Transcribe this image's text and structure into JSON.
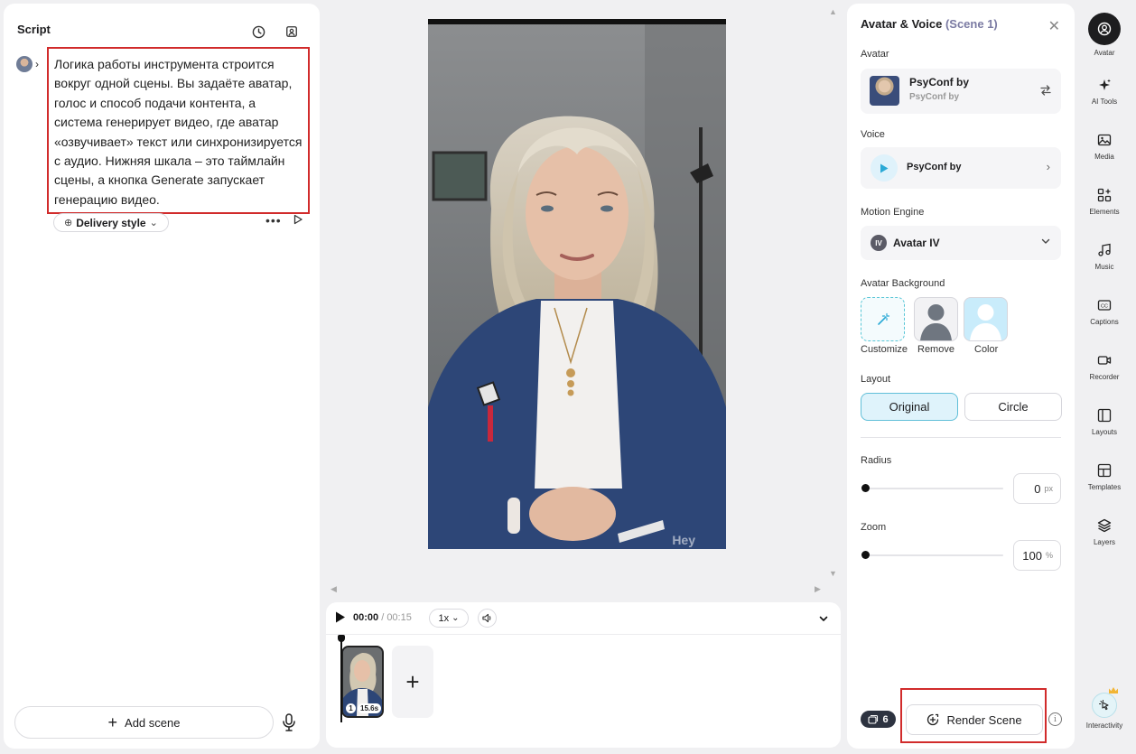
{
  "script_panel": {
    "title": "Script",
    "script_text": "Логика работы инструмента строится вокруг одной сцены. Вы задаёте аватар, голос и способ подачи контента, а система генерирует видео, где аватар «озвучивает» текст или синхронизируется с аудио. Нижняя шкала – это таймлайн сцены, а кнопка Generate запускает генерацию видео.",
    "delivery_style_label": "Delivery style",
    "add_scene_label": "Add scene"
  },
  "preview": {
    "watermark": "Hey"
  },
  "timeline": {
    "current_time": "00:00",
    "separator": " / ",
    "total_time": "00:15",
    "speed": "1x",
    "scenes": [
      {
        "number": "1",
        "duration": "15.6s"
      }
    ]
  },
  "props_panel": {
    "title": "Avatar & Voice",
    "scene_label": "(Scene 1)",
    "avatar_label": "Avatar",
    "avatar_name": "PsyConf by",
    "avatar_sub": "PsyConf by",
    "voice_label": "Voice",
    "voice_name": "PsyConf by",
    "motion_engine_label": "Motion Engine",
    "engine_badge": "IV",
    "engine_name": "Avatar IV",
    "background_label": "Avatar Background",
    "background_options": [
      "Customize",
      "Remove",
      "Color"
    ],
    "layout_label": "Layout",
    "layout_options": [
      "Original",
      "Circle"
    ],
    "layout_selected": "Original",
    "radius_label": "Radius",
    "radius_value": "0",
    "radius_unit": "px",
    "zoom_label": "Zoom",
    "zoom_value": "100",
    "zoom_unit": "%",
    "credits": "6",
    "render_label": "Render Scene"
  },
  "rail": {
    "items": [
      {
        "label": "Avatar",
        "icon": "avatar-icon"
      },
      {
        "label": "AI Tools",
        "icon": "sparkle-icon"
      },
      {
        "label": "Media",
        "icon": "image-icon"
      },
      {
        "label": "Elements",
        "icon": "elements-icon"
      },
      {
        "label": "Music",
        "icon": "music-icon"
      },
      {
        "label": "Captions",
        "icon": "captions-icon"
      },
      {
        "label": "Recorder",
        "icon": "recorder-icon"
      },
      {
        "label": "Layouts",
        "icon": "layouts-icon"
      },
      {
        "label": "Templates",
        "icon": "templates-icon"
      },
      {
        "label": "Layers",
        "icon": "layers-icon"
      }
    ],
    "interactivity_label": "Interactivity"
  },
  "colors": {
    "accent_cyan": "#61bfd8",
    "highlight_red": "#d12b2b",
    "dark": "#1d1d1f"
  }
}
